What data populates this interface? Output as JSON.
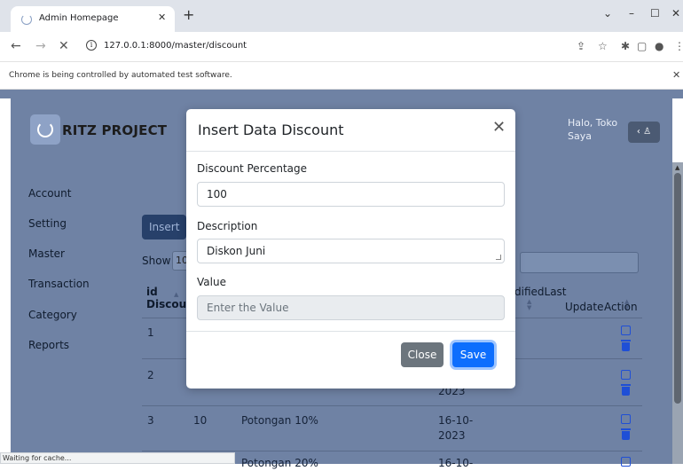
{
  "browser": {
    "tab_title": "Admin Homepage",
    "url": "127.0.0.1:8000/master/discount",
    "automation_notice": "Chrome is being controlled by automated test software.",
    "status_text": "Waiting for cache..."
  },
  "header": {
    "brand": "RITZ PROJECT",
    "greeting_line1": "Halo, Toko",
    "greeting_line2": "Saya"
  },
  "sidebar": {
    "items": [
      {
        "label": "Account"
      },
      {
        "label": "Setting"
      },
      {
        "label": "Master"
      },
      {
        "label": "Transaction"
      },
      {
        "label": "Category"
      },
      {
        "label": "Reports"
      }
    ]
  },
  "main": {
    "insert_button_label": "Insert D",
    "show_label": "Show",
    "show_value": "10",
    "columns": {
      "id_line1": "id",
      "id_line2": "Discou",
      "modified": "difiedLast",
      "last_update": "Update",
      "action": "Action"
    },
    "rows": [
      {
        "id": "1",
        "percentage": "",
        "description": "",
        "date_line1": "",
        "date_line2": ""
      },
      {
        "id": "2",
        "percentage": "",
        "description": "",
        "date_line1": "",
        "date_line2": "2023"
      },
      {
        "id": "3",
        "percentage": "10",
        "description": "Potongan 10%",
        "date_line1": "16-10-",
        "date_line2": "2023"
      },
      {
        "id": "",
        "percentage": "",
        "description": "Potongan 20%",
        "date_line1": "16-10-",
        "date_line2": ""
      }
    ]
  },
  "modal": {
    "title": "Insert Data Discount",
    "fields": {
      "percentage_label": "Discount Percentage",
      "percentage_value": "100",
      "description_label": "Description",
      "description_value": "Diskon Juni",
      "value_label": "Value",
      "value_placeholder": "Enter the Value"
    },
    "close_label": "Close",
    "save_label": "Save"
  },
  "colors": {
    "overlay_bg": "#6f82a4",
    "primary": "#0d6efd",
    "secondary": "#6c757d",
    "action_icon": "#1f4fd6"
  }
}
